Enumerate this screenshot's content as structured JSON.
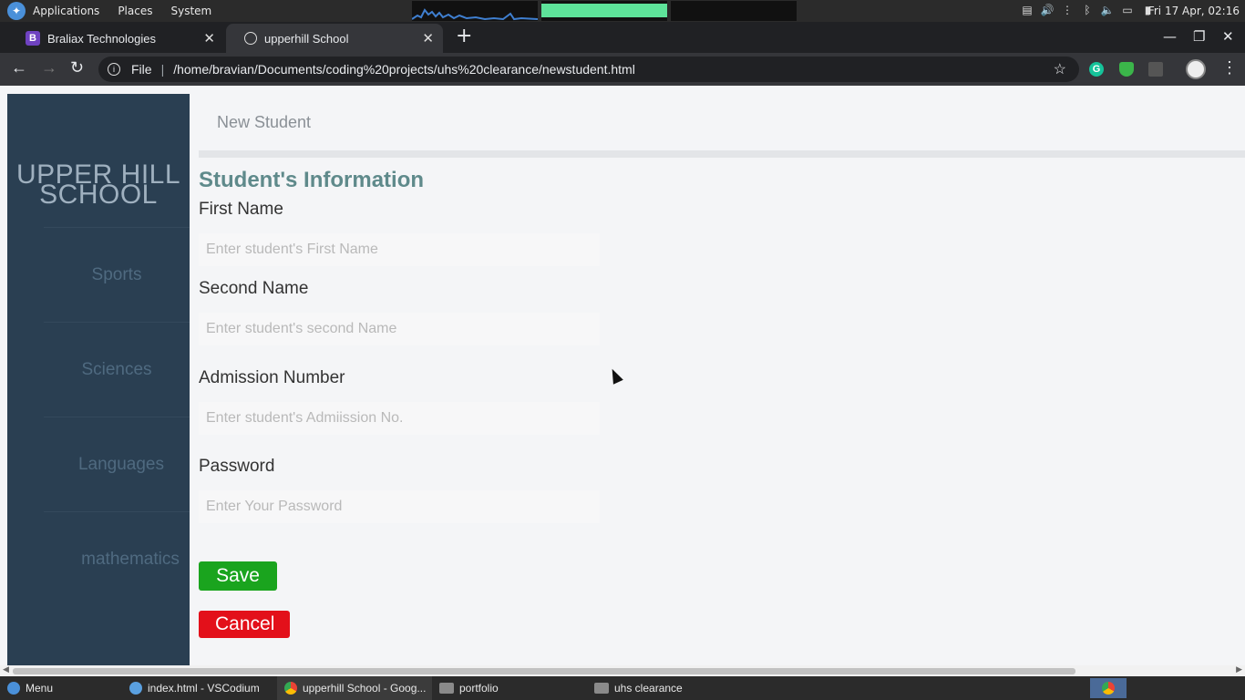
{
  "os_panel": {
    "menus": [
      "Applications",
      "Places",
      "System"
    ],
    "clock": "Fri 17 Apr, 02:16"
  },
  "browser": {
    "tabs": [
      {
        "title": "Braliax Technologies",
        "favicon_letter": "B"
      },
      {
        "title": "upperhill School"
      }
    ],
    "scheme_label": "File",
    "url": "/home/bravian/Documents/coding%20projects/uhs%20clearance/newstudent.html",
    "grammarly_letter": "G"
  },
  "page": {
    "brand": "UPPER HILL SCHOOL",
    "sidebar_items": [
      "Sports",
      "Sciences",
      "Languages",
      "mathematics"
    ],
    "topbar_title": "New Student",
    "form_heading": "Student's Information",
    "fields": [
      {
        "label": "First Name",
        "placeholder": "Enter student's First Name",
        "value": ""
      },
      {
        "label": "Second Name",
        "placeholder": "Enter student's second Name",
        "value": ""
      },
      {
        "label": "Admission Number",
        "placeholder": "Enter student's Admiission No.",
        "value": ""
      },
      {
        "label": "Password",
        "placeholder": "Enter Your Password",
        "value": ""
      }
    ],
    "save_label": "Save",
    "cancel_label": "Cancel",
    "colors": {
      "save": "#1aa41e",
      "cancel": "#e3101a",
      "sidebar": "#2a3f52",
      "heading": "#5f8a8b"
    }
  },
  "taskbar": {
    "menu_label": "Menu",
    "tasks": [
      "index.html - VSCodium",
      "upperhill School - Goog...",
      "portfolio",
      "uhs clearance"
    ]
  }
}
